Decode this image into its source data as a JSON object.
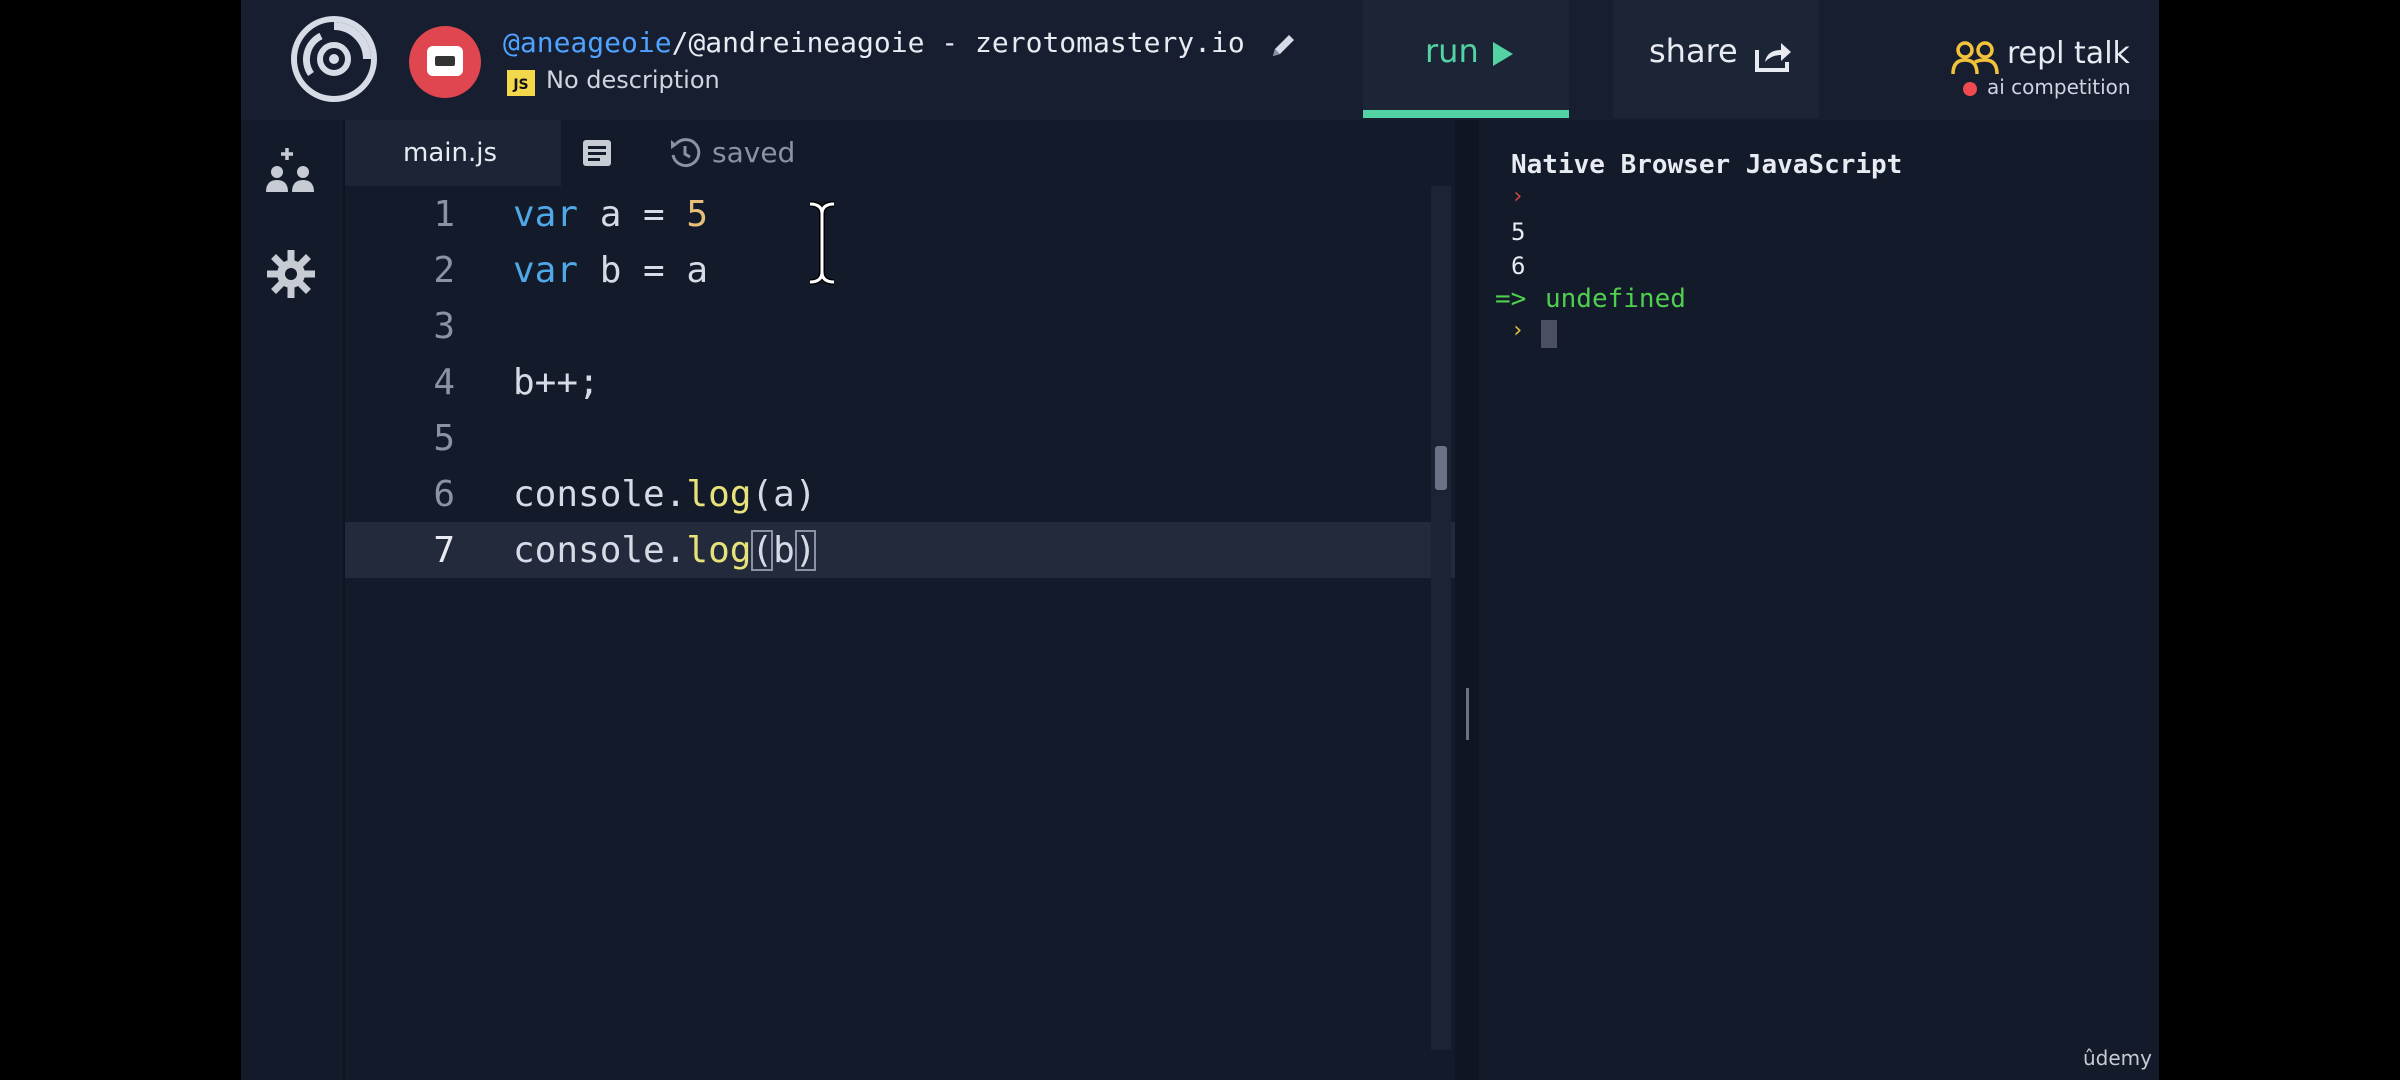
{
  "header": {
    "owner": "@aneageoie",
    "separator": "/",
    "repl_name": "@andreineagoie - zerotomastery.io",
    "language_badge": "JS",
    "description": "No description",
    "run_label": "run",
    "share_label": "share",
    "talk_label": "repl talk",
    "talk_sublabel": "ai competition"
  },
  "left_rail": {
    "icons": [
      "add-users-icon",
      "gear-icon"
    ]
  },
  "editor": {
    "active_tab": "main.js",
    "save_status": "saved",
    "lines": [
      {
        "num": "1",
        "tokens": [
          {
            "t": "var",
            "c": "kw"
          },
          {
            "t": " a = ",
            "c": ""
          },
          {
            "t": "5",
            "c": "num"
          }
        ]
      },
      {
        "num": "2",
        "tokens": [
          {
            "t": "var",
            "c": "kw"
          },
          {
            "t": " b = a",
            "c": ""
          }
        ]
      },
      {
        "num": "3",
        "tokens": []
      },
      {
        "num": "4",
        "tokens": [
          {
            "t": "b++;",
            "c": ""
          }
        ]
      },
      {
        "num": "5",
        "tokens": []
      },
      {
        "num": "6",
        "tokens": [
          {
            "t": "console.",
            "c": ""
          },
          {
            "t": "log",
            "c": "fn"
          },
          {
            "t": "(a)",
            "c": ""
          }
        ]
      },
      {
        "num": "7",
        "tokens": [
          {
            "t": "console.",
            "c": ""
          },
          {
            "t": "log",
            "c": "fn"
          },
          {
            "t": "(",
            "c": "br"
          },
          {
            "t": "b",
            "c": ""
          },
          {
            "t": ")",
            "c": "br"
          }
        ]
      }
    ],
    "active_line": "7"
  },
  "console": {
    "title": "Native Browser JavaScript",
    "prompt_symbol": "›",
    "outputs": [
      "5",
      "6"
    ],
    "result_arrow": "=>",
    "result_value": "undefined"
  },
  "watermark": "ûdemy",
  "colors": {
    "accent_green": "#53d3a3",
    "background": "#131a2a",
    "keyword_blue": "#4fa8e8",
    "result_green": "#4fcf4f"
  }
}
